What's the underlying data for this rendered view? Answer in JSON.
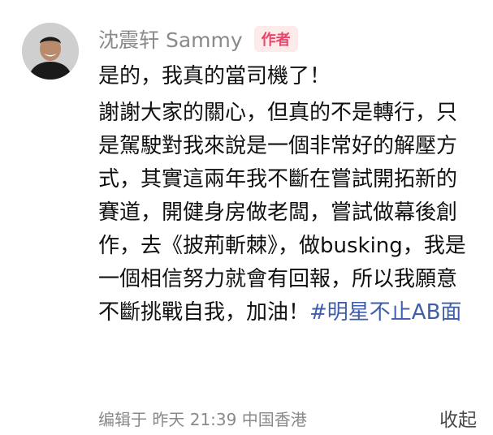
{
  "comment": {
    "author": {
      "name": "沈震轩 Sammy",
      "tag": "作者",
      "avatar_icon": "person-avatar-icon"
    },
    "body": {
      "first_line": "是的，我真的當司機了！",
      "text": "謝謝大家的關心，但真的不是轉行，只是駕駛對我來說是一個非常好的解壓方式，其實這兩年我不斷在嘗試開拓新的賽道，開健身房做老闆，嘗試做幕後創作，去《披荊斬棘》，做busking，我是一個相信努力就會有回報，所以我願意不斷挑戰自我，加油！",
      "hashtag": "#明星不止AB面"
    },
    "footer": {
      "meta": "编辑于  昨天 21:39 中国香港",
      "collapse_label": "收起"
    },
    "colors": {
      "tag_bg": "#fdeaea",
      "tag_text": "#e8456b",
      "hashtag": "#3e5fa8",
      "meta": "#8a8a8a"
    }
  }
}
